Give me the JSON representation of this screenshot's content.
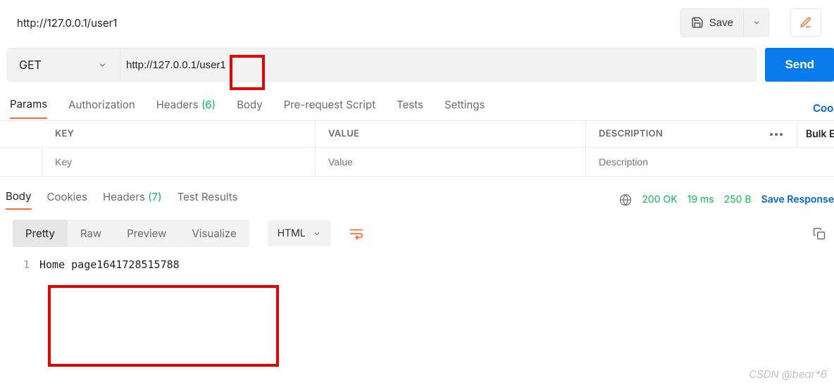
{
  "title": "http://127.0.0.1/user1",
  "toolbar": {
    "save_label": "Save",
    "edit_label": "Edit"
  },
  "request": {
    "method": "GET",
    "url": "http://127.0.0.1/user1",
    "send_label": "Send"
  },
  "req_tabs": {
    "params": "Params",
    "authorization": "Authorization",
    "headers_label": "Headers",
    "headers_count": "(6)",
    "body": "Body",
    "prerequest": "Pre-request Script",
    "tests": "Tests",
    "settings": "Settings",
    "cookies_link": "Cookies"
  },
  "params_table": {
    "header_key": "KEY",
    "header_value": "VALUE",
    "header_desc": "DESCRIPTION",
    "bulk_label": "Bulk Edit",
    "key_placeholder": "Key",
    "value_placeholder": "Value",
    "desc_placeholder": "Description"
  },
  "resp_tabs": {
    "body": "Body",
    "cookies": "Cookies",
    "headers_label": "Headers",
    "headers_count": "(7)",
    "test_results": "Test Results"
  },
  "status": {
    "code": "200 OK",
    "time": "19 ms",
    "size": "250 B",
    "save_response": "Save Response"
  },
  "viewer": {
    "pretty": "Pretty",
    "raw": "Raw",
    "preview": "Preview",
    "visualize": "Visualize",
    "format": "HTML"
  },
  "code": {
    "line_no": "1",
    "content": "Home page1641728515788"
  },
  "watermark": "CSDN @bear*6"
}
